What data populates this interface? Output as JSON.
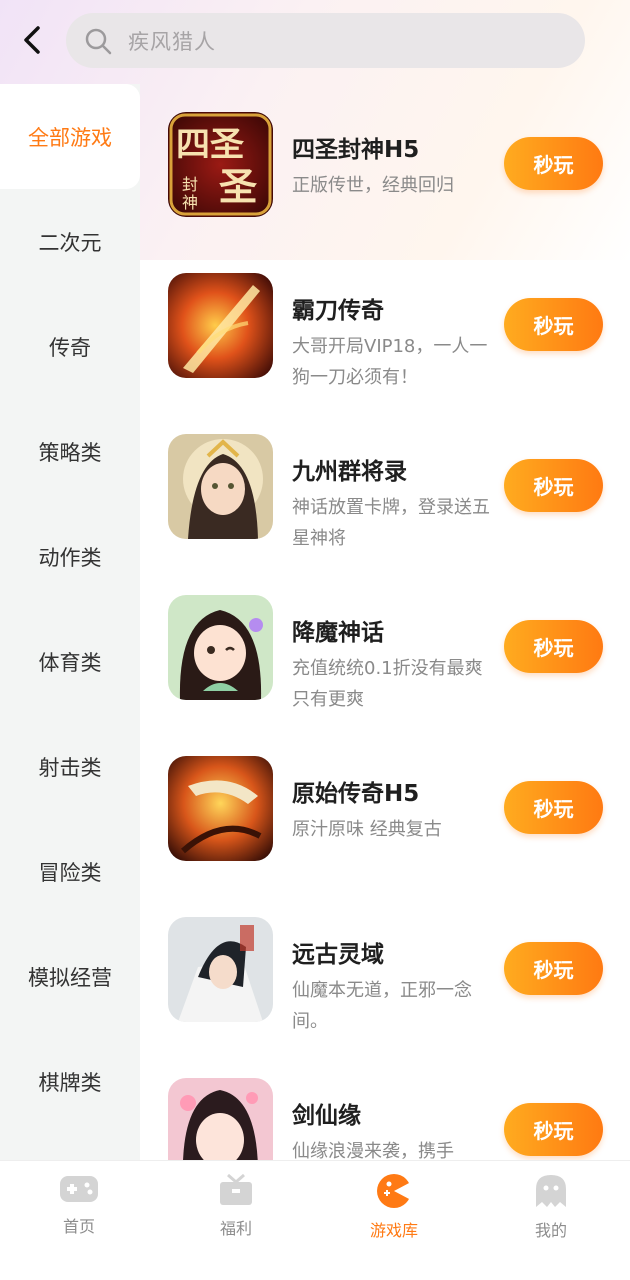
{
  "header": {
    "search_placeholder": "疾风猎人"
  },
  "sidebar": {
    "items": [
      {
        "label": "全部游戏",
        "active": true
      },
      {
        "label": "二次元"
      },
      {
        "label": "传奇"
      },
      {
        "label": "策略类"
      },
      {
        "label": "动作类"
      },
      {
        "label": "体育类"
      },
      {
        "label": "射击类"
      },
      {
        "label": "冒险类"
      },
      {
        "label": "模拟经营"
      },
      {
        "label": "棋牌类"
      }
    ]
  },
  "games": [
    {
      "title": "四圣封神H5",
      "desc": "正版传世，经典回归",
      "button": "秒玩",
      "icon_text": "四圣",
      "icon_sub": "封神"
    },
    {
      "title": "霸刀传奇",
      "desc": "大哥开局VIP18，一人一狗一刀必须有！",
      "button": "秒玩"
    },
    {
      "title": "九州群将录",
      "desc": "神话放置卡牌，登录送五星神将",
      "button": "秒玩"
    },
    {
      "title": "降魔神话",
      "desc": "充值统统0.1折没有最爽只有更爽",
      "button": "秒玩"
    },
    {
      "title": "原始传奇H5",
      "desc": "原汁原味 经典复古",
      "button": "秒玩"
    },
    {
      "title": "远古灵域",
      "desc": "仙魔本无道，正邪一念间。",
      "button": "秒玩"
    },
    {
      "title": "剑仙缘",
      "desc": "仙缘浪漫来袭，携手",
      "button": "秒玩"
    }
  ],
  "tabbar": {
    "items": [
      {
        "label": "首页",
        "icon": "gamepad-icon"
      },
      {
        "label": "福利",
        "icon": "gift-icon"
      },
      {
        "label": "游戏库",
        "icon": "game-library-icon",
        "active": true
      },
      {
        "label": "我的",
        "icon": "ghost-profile-icon"
      }
    ]
  },
  "colors": {
    "accent": "#ff7a14",
    "button_gradient_start": "#ffab1f",
    "button_gradient_end": "#ff7a12",
    "sidebar_bg": "#f3f5f4"
  }
}
